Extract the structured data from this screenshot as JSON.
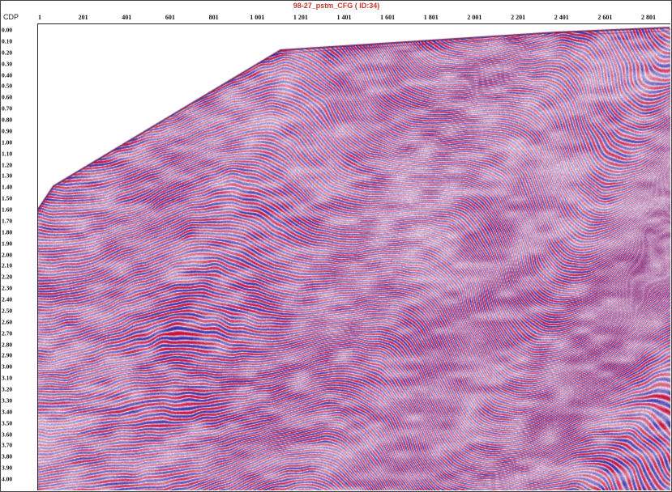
{
  "title": "98-27_pstm_CFG ( ID:34)",
  "axis": {
    "cdp_label": "CDP",
    "x_ticks": [
      "1",
      "201",
      "401",
      "601",
      "801",
      "1 001",
      "1 201",
      "1 401",
      "1 601",
      "1 801",
      "2 001",
      "2 201",
      "2 401",
      "2 601",
      "2 801"
    ],
    "y_ticks": [
      "0.00",
      "0.10",
      "0.20",
      "0.30",
      "0.40",
      "0.50",
      "0.60",
      "0.70",
      "0.80",
      "0.90",
      "1.00",
      "1.10",
      "1.20",
      "1.30",
      "1.40",
      "1.50",
      "1.60",
      "1.70",
      "1.80",
      "1.90",
      "2.00",
      "2.10",
      "2.20",
      "2.30",
      "2.40",
      "2.50",
      "2.60",
      "2.70",
      "2.80",
      "2.90",
      "3.00",
      "3.10",
      "3.20",
      "3.30",
      "3.40",
      "3.50",
      "3.60",
      "3.70",
      "3.80",
      "3.90",
      "4.00"
    ]
  },
  "colors": {
    "positive": "#c8102e",
    "negative": "#1f2fa8",
    "mid": "#f4eef6",
    "title": "#c0392b"
  }
}
